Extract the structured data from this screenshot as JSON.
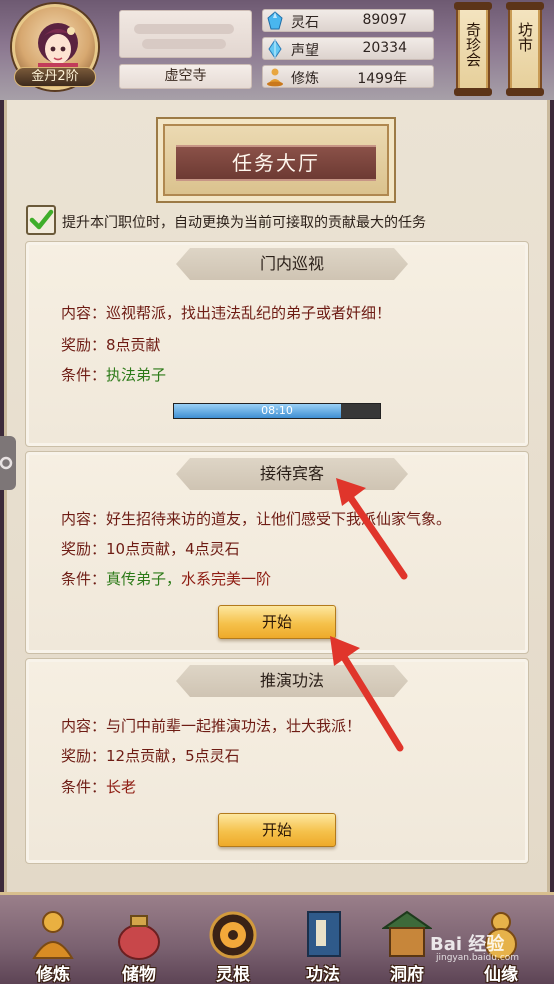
{
  "player": {
    "rank": "金丹2阶",
    "sect": "虚空寺"
  },
  "stats": [
    {
      "icon": "crystal-icon",
      "label": "灵石",
      "value": "89097"
    },
    {
      "icon": "gem-icon",
      "label": "声望",
      "value": "20334"
    },
    {
      "icon": "meditation-icon",
      "label": "修炼",
      "value": "1499年"
    }
  ],
  "top_buttons": {
    "treasure_fair": "奇珍会",
    "market": "坊市"
  },
  "page": {
    "title": "任务大厅",
    "auto_switch_note": "提升本门职位时，自动更换为当前可接取的贡献最大的任务",
    "auto_switch_checked": true
  },
  "tasks": [
    {
      "name": "门内巡视",
      "content_label": "内容：",
      "content": "巡视帮派，找出违法乱纪的弟子或者奸细！",
      "reward_label": "奖励：",
      "reward": "8点贡献",
      "condition_label": "条件：",
      "condition": "执法弟子",
      "progress_text": "08:10",
      "progress_fraction": 0.81
    },
    {
      "name": "接待宾客",
      "content_label": "内容：",
      "content": "好生招待来访的道友，让他们感受下我派仙家气象。",
      "reward_label": "奖励：",
      "reward": "10点贡献，4点灵石",
      "condition_label": "条件：",
      "condition_part1": "真传弟子，",
      "condition_part2": "水系完美一阶",
      "button": "开始"
    },
    {
      "name": "推演功法",
      "content_label": "内容：",
      "content": "与门中前辈一起推演功法，壮大我派！",
      "reward_label": "奖励：",
      "reward": "12点贡献，5点灵石",
      "condition_label": "条件：",
      "condition": "长老",
      "button": "开始"
    }
  ],
  "bottom_nav": [
    {
      "icon": "monk-icon",
      "label": "修炼"
    },
    {
      "icon": "bag-icon",
      "label": "储物"
    },
    {
      "icon": "triskelion-icon",
      "label": "灵根"
    },
    {
      "icon": "book-icon",
      "label": "功法"
    },
    {
      "icon": "house-icon",
      "label": "洞府"
    },
    {
      "icon": "gourd-icon",
      "label": "仙缘"
    }
  ],
  "watermark": {
    "text": "Bai 经验",
    "sub": "jingyan.baidu.com"
  },
  "colors": {
    "title_ribbon": "#7a4540",
    "green_text": "#2c7a18",
    "red_text": "#8e1c12",
    "button_gold": "#f5c14b",
    "arrow_red": "#e0352b"
  }
}
